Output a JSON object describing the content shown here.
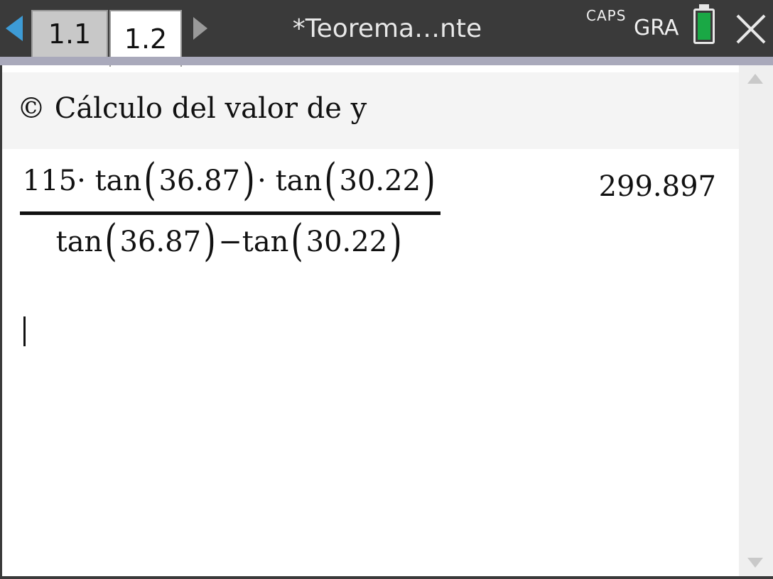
{
  "header": {
    "tabs": [
      {
        "label": "1.1",
        "active": false
      },
      {
        "label": "1.2",
        "active": true
      }
    ],
    "document_title": "*Teorema…nte",
    "caps_indicator": "CAPS",
    "angle_mode": "GRA",
    "battery_color": "#1aa845"
  },
  "calculator": {
    "comment": "© Cálculo del valor de y",
    "entry": {
      "numerator": {
        "factor": "115·",
        "func1": "tan",
        "arg1": "36.87",
        "dot": "·",
        "func2": "tan",
        "arg2": "30.22"
      },
      "denominator": {
        "func1": "tan",
        "arg1": "36.87",
        "minus": "−",
        "func2": "tan",
        "arg2": "30.22"
      },
      "result": "299.897"
    }
  },
  "icons": [
    "left-arrow-icon",
    "right-arrow-icon",
    "battery-icon",
    "close-icon",
    "scroll-up-icon",
    "scroll-down-icon"
  ]
}
